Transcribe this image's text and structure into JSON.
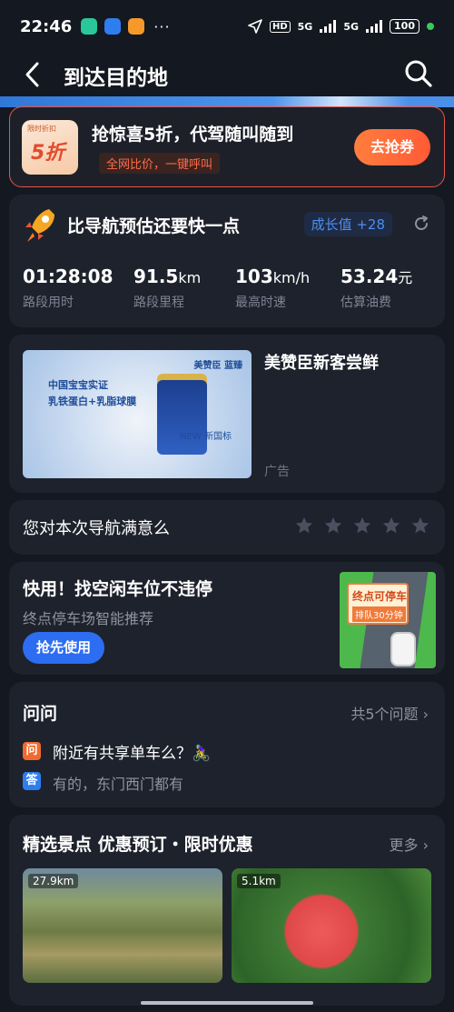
{
  "status_bar": {
    "time": "22:46",
    "extra": "···",
    "network1": "5G",
    "network2": "5G",
    "hd": "HD",
    "battery": "100"
  },
  "nav": {
    "title": "到达目的地"
  },
  "promo": {
    "icon_tag": "限时折扣",
    "icon_text": "5折",
    "title": "抢惊喜5折，代驾随叫随到",
    "subtitle": "全网比价，一键呼叫",
    "button": "去抢券"
  },
  "stats": {
    "title": "比导航预估还要快一点",
    "growth_badge": "成长值 +28",
    "items": [
      {
        "value": "01:28:08",
        "unit": "",
        "label": "路段用时"
      },
      {
        "value": "91.5",
        "unit": "km",
        "label": "路段里程"
      },
      {
        "value": "103",
        "unit": "km/h",
        "label": "最高时速"
      },
      {
        "value": "53.24",
        "unit": "元",
        "label": "估算油费"
      }
    ]
  },
  "ad": {
    "line1": "中国宝宝实证",
    "line2": "乳铁蛋白+乳脂球膜",
    "brand": "美赞臣 蓝臻",
    "new_tag": "NEW 新国标",
    "title": "美赞臣新客尝鲜",
    "label": "广告"
  },
  "rating": {
    "question": "您对本次导航满意么",
    "stars": 5
  },
  "parking": {
    "title": "快用！找空闲车位不违停",
    "subtitle": "终点停车场智能推荐",
    "button": "抢先使用",
    "sign_line1": "终点可停车",
    "sign_line2": "排队30分钟"
  },
  "qa": {
    "title": "问问",
    "count": "共5个问题 ›",
    "q_badge": "问",
    "question": "附近有共享单车么？🚴‍♀️",
    "a_badge": "答",
    "answer": "有的，东门西门都有"
  },
  "scenic": {
    "title": "精选景点 优惠预订・限时优惠",
    "more": "更多 ›",
    "photos": [
      {
        "distance": "27.9km"
      },
      {
        "distance": "5.1km"
      }
    ]
  },
  "colors": {
    "accent": "#ff5a36",
    "primary_blue": "#2d6df2",
    "background": "#141820",
    "card": "#1e222c"
  }
}
